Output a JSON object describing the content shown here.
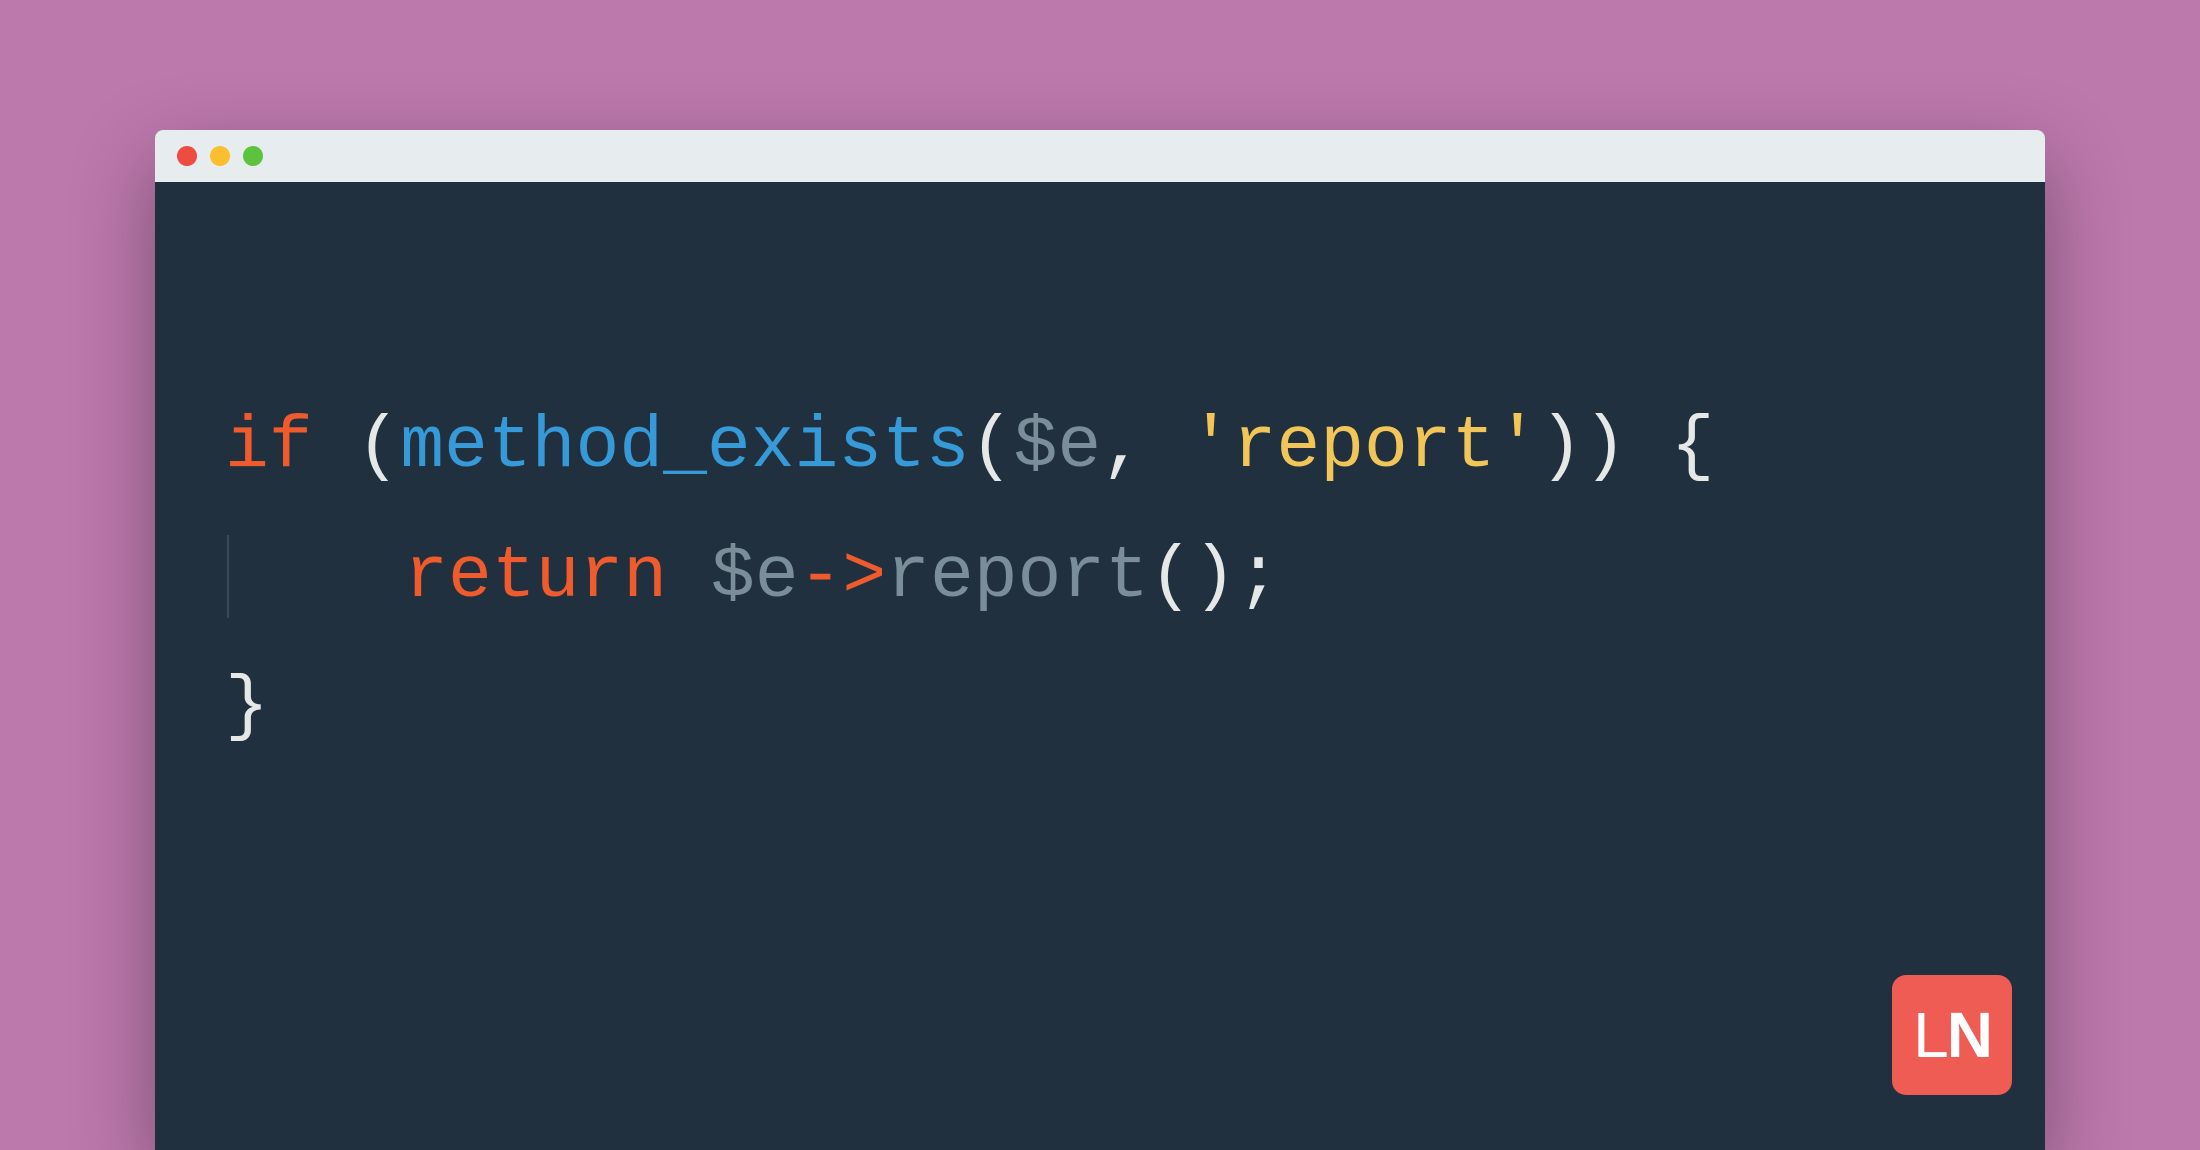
{
  "code": {
    "line1": {
      "keyword": "if",
      "open_paren": " (",
      "function": "method_exists",
      "args_open": "(",
      "var": "$e",
      "comma": ", ",
      "string": "'report'",
      "args_close": "))",
      "brace_open": " {"
    },
    "line2": {
      "indent": "    ",
      "keyword": "return",
      "space": " ",
      "var": "$e",
      "arrow": "->",
      "method": "report",
      "parens": "()",
      "semi": ";"
    },
    "line3": {
      "brace_close": "}"
    }
  },
  "logo": {
    "text_l": "L",
    "text_n": "N"
  }
}
